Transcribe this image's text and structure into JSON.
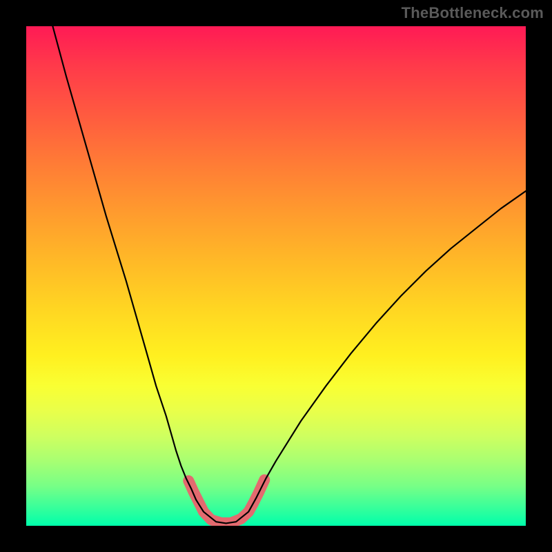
{
  "watermark": {
    "text": "TheBottleneck.com"
  },
  "colors": {
    "frame": "#000000",
    "curve": "#000000",
    "pink_highlight": "#e36a6f",
    "gradient_top": "#ff1a55",
    "gradient_mid": "#fff020",
    "gradient_bottom": "#00ffab"
  },
  "chart_data": {
    "type": "line",
    "title": "",
    "xlabel": "",
    "ylabel": "",
    "xlim": [
      0,
      100
    ],
    "ylim": [
      0,
      100
    ],
    "grid": false,
    "legend": false,
    "note": "Axis ticks and units are not shown in the source image; values below are normalized 0–100 estimates read from pixel positions (0 = left/bottom, 100 = right/top).",
    "series": [
      {
        "name": "black_curve_left",
        "description": "Steep descending left arm of the V-curve",
        "x": [
          5.3,
          8,
          12,
          16,
          20,
          24,
          26,
          28,
          30,
          31,
          32,
          33,
          34,
          35.5
        ],
        "y": [
          100,
          90,
          76,
          62,
          49,
          35,
          28,
          22,
          15,
          12,
          9.5,
          7.5,
          5.2,
          2.8
        ]
      },
      {
        "name": "black_curve_flat",
        "description": "Near-zero trough of the V-curve",
        "x": [
          35.5,
          38,
          40,
          42,
          44.5
        ],
        "y": [
          2.8,
          0.8,
          0.5,
          0.8,
          2.8
        ]
      },
      {
        "name": "black_curve_right",
        "description": "Ascending right arm of the V-curve, shallower than the left",
        "x": [
          44.5,
          46,
          48,
          50,
          55,
          60,
          65,
          70,
          75,
          80,
          85,
          90,
          95,
          100
        ],
        "y": [
          2.8,
          5.5,
          9.5,
          13,
          21,
          28,
          34.5,
          40.5,
          46,
          51,
          55.5,
          59.5,
          63.5,
          67
        ]
      },
      {
        "name": "pink_highlight",
        "description": "Thick pink overlay near the minimum of the curve",
        "x": [
          32.5,
          33.5,
          34.5,
          35.5,
          37,
          39,
          41,
          43,
          44.5,
          45.5,
          46.5,
          47.7
        ],
        "y": [
          9,
          6.8,
          4.8,
          2.8,
          1.2,
          0.6,
          0.6,
          1.4,
          2.8,
          4.6,
          6.6,
          9.2
        ]
      }
    ]
  }
}
